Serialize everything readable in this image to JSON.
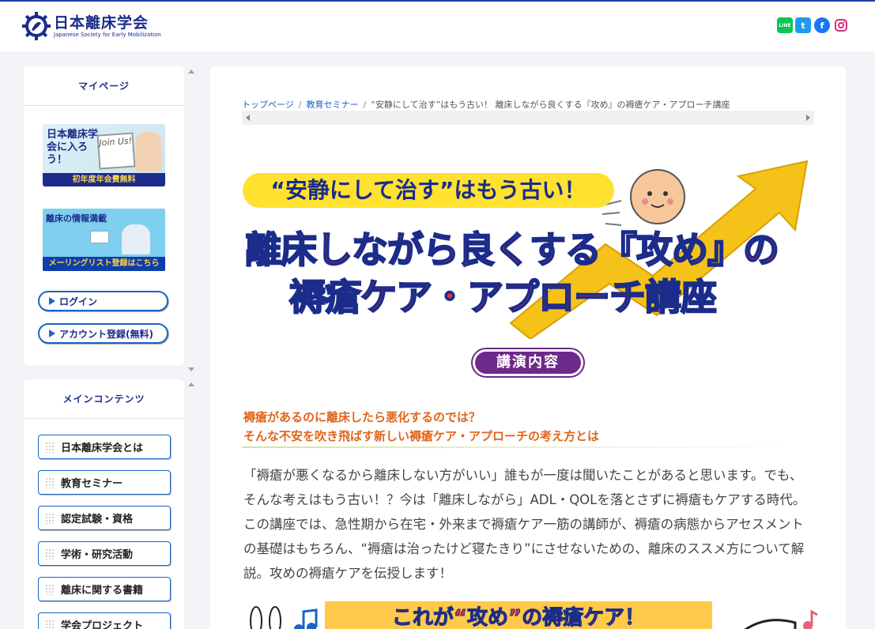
{
  "header": {
    "logo_jp": "日本離床学会",
    "logo_en": "Japanese Society for Early Mobilization",
    "sns": {
      "line": "LINE",
      "twitter": "t",
      "facebook": "f",
      "instagram": "◎"
    }
  },
  "sidebar": {
    "mypage": {
      "title": "マイページ",
      "join_banner": {
        "text": "日本離床学会に入ろう！",
        "board": "Join Us!",
        "footer": "初年度年会費無料"
      },
      "mail_banner": {
        "text": "離床の情報満載",
        "footer": "メーリングリスト登録はこちら"
      },
      "login_label": "ログイン",
      "register_label": "アカウント登録(無料)"
    },
    "main_contents": {
      "title": "メインコンテンツ",
      "items": [
        "日本離床学会とは",
        "教育セミナー",
        "認定試験・資格",
        "学術・研究活動",
        "離床に関する書籍",
        "学会プロジェクト"
      ]
    }
  },
  "breadcrumb": {
    "top": "トップページ",
    "seminar": "教育セミナー",
    "current": "“安静にして治す”はもう古い！ 離床しながら良くする『攻め』の褥瘡ケア・アプローチ講座"
  },
  "hero": {
    "subtitle": "“安静にして治す”はもう古い！",
    "title_line1": "離床しながら良くする『攻め』の",
    "title_line2": "褥瘡ケア・アプローチ講座"
  },
  "lecture_tag": "講演内容",
  "lead": {
    "line1": "褥瘡があるのに離床したら悪化するのでは？",
    "line2": "そんな不安を吹き飛ばす新しい褥瘡ケア・アプローチの考え方とは"
  },
  "body_text": "「褥瘡が悪くなるから離床しない方がいい」誰もが一度は聞いたことがあると思います。でも、そんな考えはもう古い！？今は「離床しながら」ADL・QOLを落とさずに褥瘡もケアする時代。この講座では、急性期から在宅・外来まで褥瘡ケア一筋の講師が、褥瘡の病態からアセスメントの基礎はもちろん、“褥瘡は治ったけど寝たきり”にさせないための、離床のススメ方について解説。攻めの褥瘡ケアを伝授します！",
  "bottom_banner": "これが“攻め”の褥瘡ケア！",
  "colors": {
    "brand": "#1b2c8a",
    "accent_red": "#e32f35",
    "lead_orange": "#e0651a",
    "tag_purple": "#6c2a8a",
    "banner_yellow": "#ffe12f"
  }
}
